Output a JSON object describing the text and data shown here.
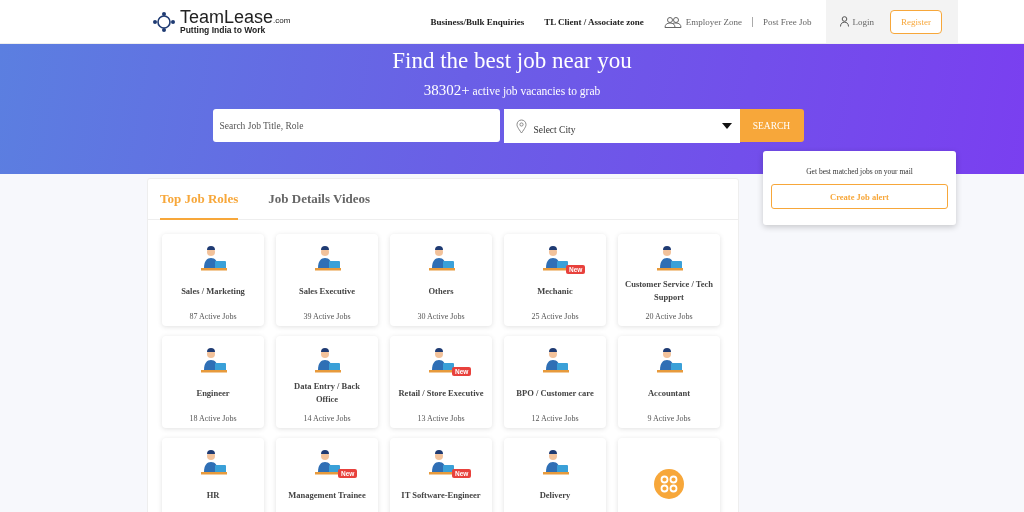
{
  "header": {
    "logo": {
      "name": "TeamLease",
      "suffix": ".com",
      "tagline": "Putting India to Work"
    },
    "nav": [
      {
        "label": "Business/Bulk Enquiries",
        "kind": "bold"
      },
      {
        "label": "TL Client / Associate zone",
        "kind": "bold"
      },
      {
        "label": "Employer Zone",
        "kind": "people"
      },
      {
        "label": "Post Free Job",
        "kind": "plain"
      },
      {
        "label": "Login",
        "kind": "user"
      }
    ],
    "register": "Register"
  },
  "hero": {
    "title": "Find the best job near you",
    "count": "38302+",
    "subtitle": "active job vacancies to grab",
    "search": {
      "placeholder": "Search Job Title, Role"
    },
    "city": {
      "value": "Select City"
    },
    "button": "SEARCH"
  },
  "tabs": [
    {
      "label": "Top Job Roles",
      "selected": true
    },
    {
      "label": "Job Details Videos",
      "selected": false
    }
  ],
  "roles": [
    {
      "title": "Sales / Marketing",
      "jobs": "87 Active Jobs"
    },
    {
      "title": "Sales Executive",
      "jobs": "39 Active Jobs"
    },
    {
      "title": "Others",
      "jobs": "30 Active Jobs"
    },
    {
      "title": "Mechanic",
      "jobs": "25 Active Jobs",
      "badge": "New"
    },
    {
      "title": "Customer Service / Tech Support",
      "jobs": "20 Active Jobs"
    },
    {
      "title": "Engineer",
      "jobs": "18 Active Jobs"
    },
    {
      "title": "Data Entry / Back Office",
      "jobs": "14 Active Jobs"
    },
    {
      "title": "Retail / Store Executive",
      "jobs": "13 Active Jobs",
      "badge": "New"
    },
    {
      "title": "BPO / Customer care",
      "jobs": "12 Active Jobs"
    },
    {
      "title": "Accountant",
      "jobs": "9 Active Jobs"
    },
    {
      "title": "HR"
    },
    {
      "title": "Management Trainee",
      "badge": "New"
    },
    {
      "title": "IT Software-Engineer",
      "badge": "New"
    },
    {
      "title": "Delivery"
    },
    {
      "kind": "more"
    }
  ],
  "alert": {
    "text": "Get best matched jobs on your mail",
    "button": "Create Job alert"
  }
}
